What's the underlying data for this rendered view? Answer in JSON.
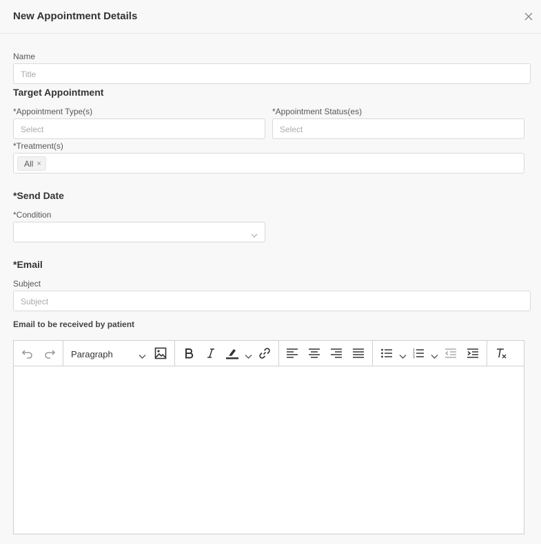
{
  "header": {
    "title": "New Appointment Details"
  },
  "name_field": {
    "label": "Name",
    "placeholder": "Title"
  },
  "target": {
    "heading": "Target Appointment",
    "type_label": "*Appointment Type(s)",
    "type_placeholder": "Select",
    "status_label": "*Appointment Status(es)",
    "status_placeholder": "Select",
    "treatment_label": "*Treatment(s)",
    "treatment_tag": "All",
    "tag_remove": "×"
  },
  "send_date": {
    "heading": "*Send Date",
    "condition_label": "*Condition",
    "condition_value": ""
  },
  "email": {
    "heading": "*Email",
    "subject_label": "Subject",
    "subject_placeholder": "Subject",
    "body_label": "Email to be received by patient"
  },
  "editor": {
    "block_format": "Paragraph",
    "content": ""
  }
}
